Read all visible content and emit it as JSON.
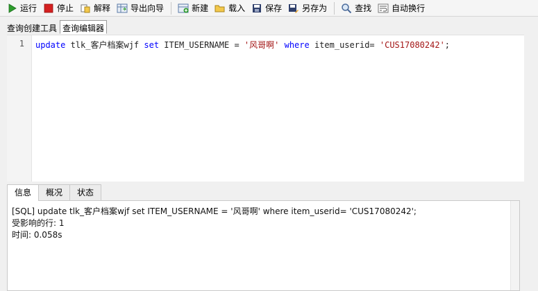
{
  "toolbar": {
    "run": "运行",
    "stop": "停止",
    "explain": "解释",
    "export_wizard": "导出向导",
    "new": "新建",
    "load": "载入",
    "save": "保存",
    "save_as": "另存为",
    "find": "查找",
    "word_wrap": "自动换行"
  },
  "editor_tabs": [
    "查询创建工具",
    "查询编辑器"
  ],
  "editor": {
    "line_number": "1",
    "sql": {
      "kw_update": "update",
      "table": " tlk_客户档案wjf ",
      "kw_set": "set",
      "col": " ITEM_USERNAME = ",
      "val1": "'风哥啊'",
      "sp": " ",
      "kw_where": "where",
      "cond": " item_userid= ",
      "val2": "'CUS17080242'",
      "end": ";"
    }
  },
  "output_tabs": [
    "信息",
    "概况",
    "状态"
  ],
  "output": {
    "line1": "[SQL] update tlk_客户档案wjf set ITEM_USERNAME = '风哥啊' where item_userid= 'CUS17080242';",
    "line2": "受影响的行: 1",
    "line3": "时间: 0.058s"
  },
  "colors": {
    "keyword": "#0000ff",
    "string": "#a31515",
    "run_icon": "#2e9d2e",
    "stop_icon": "#d42020"
  }
}
